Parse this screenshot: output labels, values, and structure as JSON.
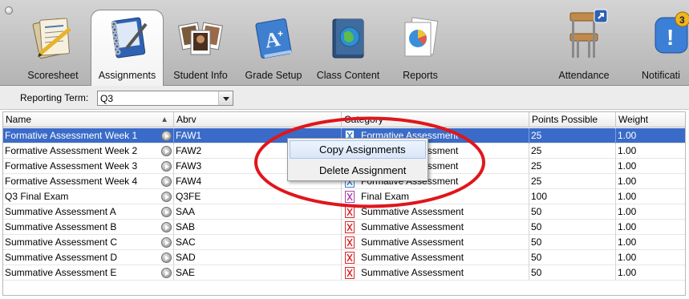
{
  "toolbar": {
    "items": [
      {
        "label": "Scoresheet",
        "icon": "scoresheet-icon"
      },
      {
        "label": "Assignments",
        "icon": "notebook-icon",
        "active": true
      },
      {
        "label": "Student Info",
        "icon": "student-photos-icon"
      },
      {
        "label": "Grade Setup",
        "icon": "grade-setup-icon"
      },
      {
        "label": "Class Content",
        "icon": "class-content-icon"
      },
      {
        "label": "Reports",
        "icon": "reports-icon"
      },
      {
        "label": "Attendance",
        "icon": "chair-icon"
      },
      {
        "label": "Notificati",
        "icon": "notification-icon",
        "badge": "3"
      }
    ]
  },
  "filter": {
    "reporting_term_label": "Reporting Term:",
    "reporting_term_value": "Q3"
  },
  "table": {
    "columns": [
      "Name",
      "Abrv",
      "Category",
      "Points Possible",
      "Weight"
    ],
    "rows": [
      {
        "name": "Formative Assessment Week 1",
        "abrv": "FAW1",
        "category": "Formative Assessment",
        "points": "25",
        "weight": "1.00",
        "selected": true
      },
      {
        "name": "Formative Assessment Week 2",
        "abrv": "FAW2",
        "category": "Formative Assessment",
        "points": "25",
        "weight": "1.00"
      },
      {
        "name": "Formative Assessment Week 3",
        "abrv": "FAW3",
        "category": "Formative Assessment",
        "points": "25",
        "weight": "1.00"
      },
      {
        "name": "Formative Assessment Week 4",
        "abrv": "FAW4",
        "category": "Formative Assessment",
        "points": "25",
        "weight": "1.00"
      },
      {
        "name": "Q3 Final Exam",
        "abrv": "Q3FE",
        "category": "Final Exam",
        "points": "100",
        "weight": "1.00"
      },
      {
        "name": "Summative Assessment A",
        "abrv": "SAA",
        "category": "Summative Assessment",
        "points": "50",
        "weight": "1.00"
      },
      {
        "name": "Summative Assessment B",
        "abrv": "SAB",
        "category": "Summative Assessment",
        "points": "50",
        "weight": "1.00"
      },
      {
        "name": "Summative Assessment C",
        "abrv": "SAC",
        "category": "Summative Assessment",
        "points": "50",
        "weight": "1.00"
      },
      {
        "name": "Summative Assessment D",
        "abrv": "SAD",
        "category": "Summative Assessment",
        "points": "50",
        "weight": "1.00"
      },
      {
        "name": "Summative Assessment E",
        "abrv": "SAE",
        "category": "Summative Assessment",
        "points": "50",
        "weight": "1.00"
      }
    ]
  },
  "context_menu": {
    "items": [
      "Copy Assignments",
      "Delete Assignment"
    ]
  },
  "colors": {
    "selection": "#3a6bc8",
    "highlight_ellipse": "#e0161b",
    "formative_icon": "#3d7ec9",
    "final_exam_icon": "#b23fb0",
    "summative_icon": "#d52b2b"
  }
}
